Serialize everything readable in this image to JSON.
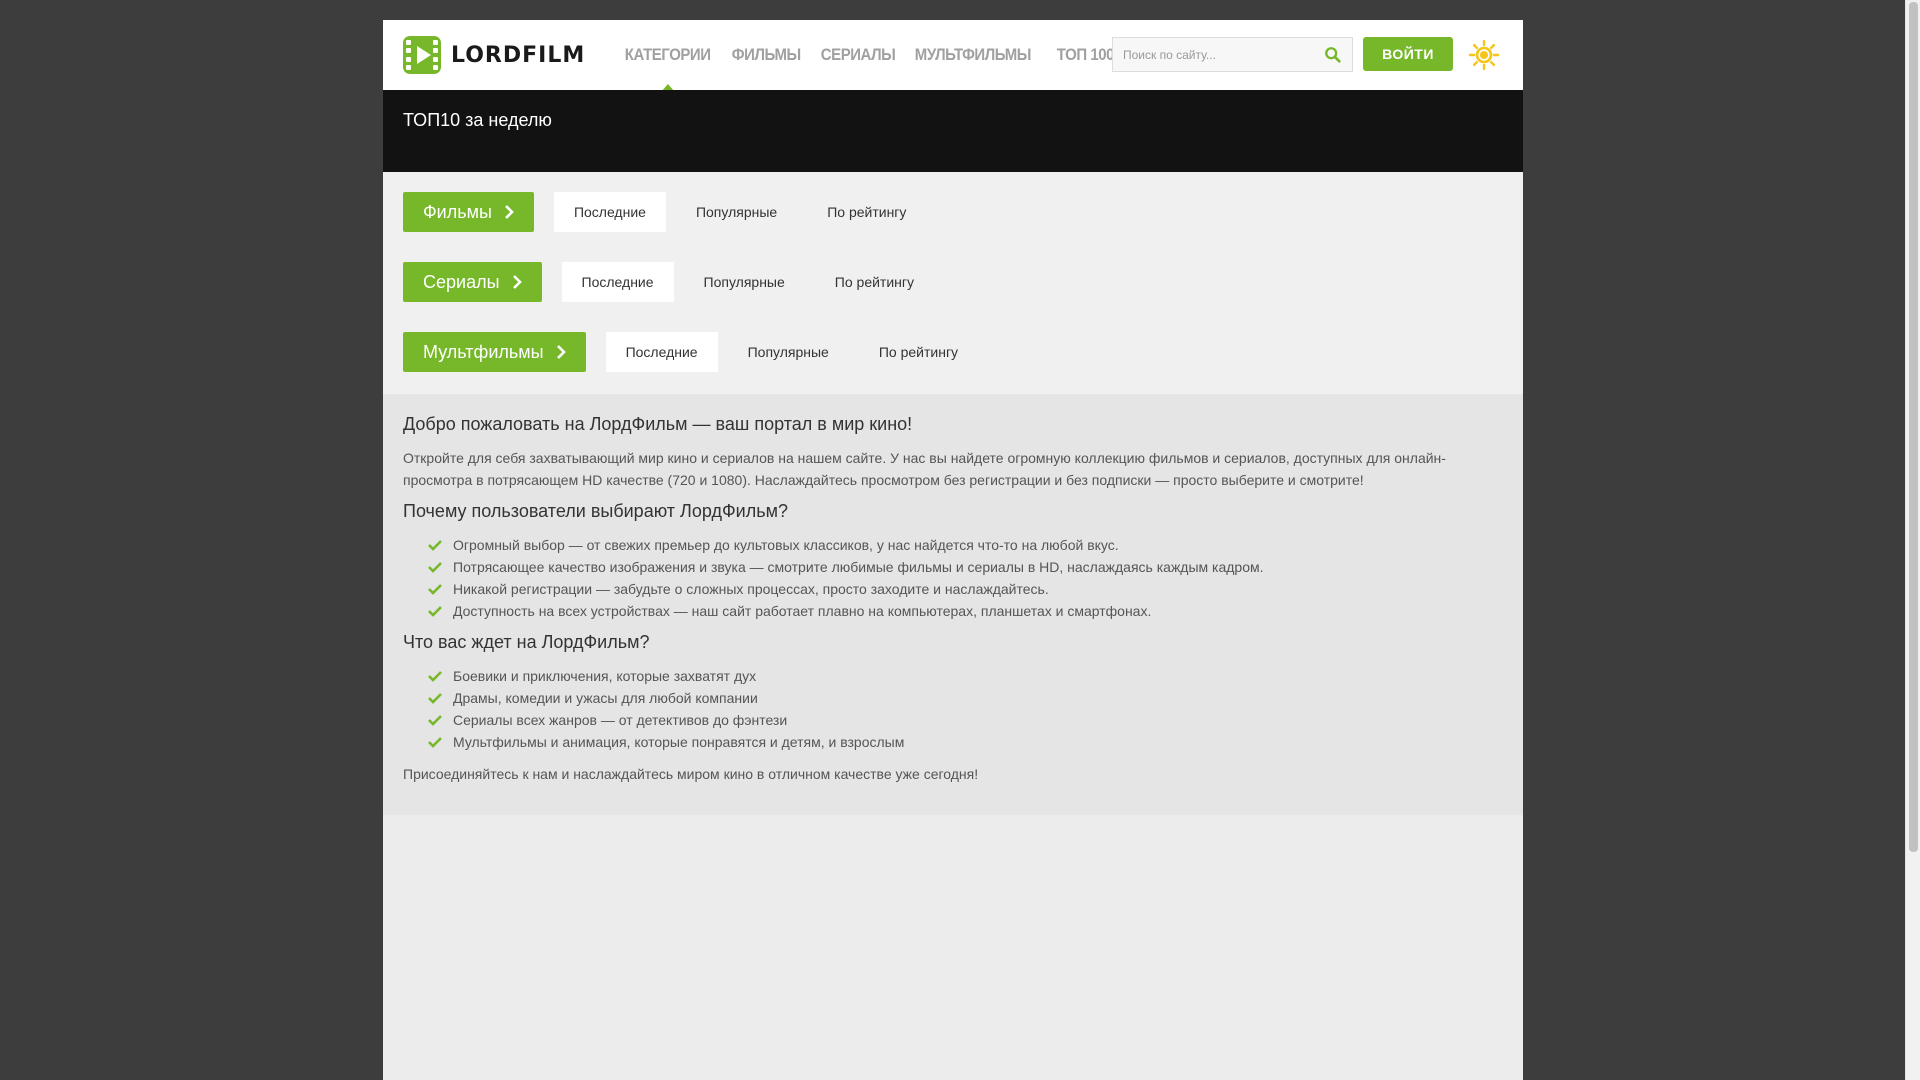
{
  "header": {
    "logo_text": "LORDFILM",
    "nav": [
      {
        "label": "КАТЕГОРИИ",
        "active": true
      },
      {
        "label": "ФИЛЬМЫ",
        "active": false
      },
      {
        "label": "СЕРИАЛЫ",
        "active": false
      },
      {
        "label": "МУЛЬТФИЛЬМЫ",
        "active": false
      },
      {
        "label": "ТОП 100",
        "active": false
      }
    ],
    "search_placeholder": "Поиск по сайту...",
    "login_label": "ВОЙТИ",
    "accent_color": "#76b82a"
  },
  "top10": {
    "title": "ТОП10 за неделю"
  },
  "categories": [
    {
      "label": "Фильмы",
      "tabs": [
        "Последние",
        "Популярные",
        "По рейтингу"
      ],
      "active_tab": 0
    },
    {
      "label": "Сериалы",
      "tabs": [
        "Последние",
        "Популярные",
        "По рейтингу"
      ],
      "active_tab": 0
    },
    {
      "label": "Мультфильмы",
      "tabs": [
        "Последние",
        "Популярные",
        "По рейтингу"
      ],
      "active_tab": 0
    }
  ],
  "article": {
    "heading1": "Добро пожаловать на ЛордФильм — ваш портал в мир кино!",
    "intro": "Откройте для себя захватывающий мир кино и сериалов на нашем сайте. У нас вы найдете огромную коллекцию фильмов и сериалов, доступных для онлайн-просмотра в потрясающем HD качестве (720 и 1080). Наслаждайтесь просмотром без регистрации и без подписки — просто выберите и смотрите!",
    "heading2": "Почему пользователи выбирают ЛордФильм?",
    "reasons": [
      "Огромный выбор — от свежих премьер до культовых классиков, у нас найдется что-то на любой вкус.",
      "Потрясающее качество изображения и звука — смотрите любимые фильмы и сериалы в HD, наслаждаясь каждым кадром.",
      "Никакой регистрации — забудьте о сложных процессах, просто заходите и наслаждайтесь.",
      "Доступность на всех устройствах — наш сайт работает плавно на компьютерах, планшетах и смартфонах."
    ],
    "heading3": "Что вас ждет на ЛордФильм?",
    "offers": [
      "Боевики и приключения, которые захватят дух",
      "Драмы, комедии и ужасы для любой компании",
      "Сериалы всех жанров — от детективов до фэнтези",
      "Мультфильмы и анимация, которые понравятся и детям, и взрослым"
    ],
    "outro": "Присоединяйтесь к нам и наслаждайтесь миром кино в отличном качестве уже сегодня!"
  }
}
